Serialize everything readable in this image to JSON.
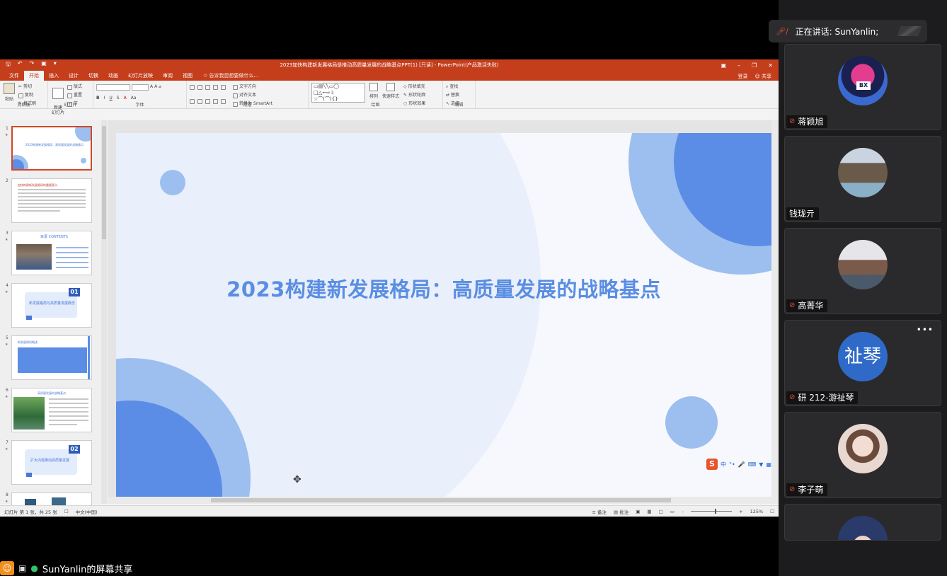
{
  "ppt": {
    "window_title": "2023加快构建新发展格局是推动高质量发展的战略基点PPT(1) [只读] - PowerPoint(产品激活失败)",
    "tabs": [
      "文件",
      "开始",
      "插入",
      "设计",
      "切换",
      "动画",
      "幻灯片放映",
      "审阅",
      "视图"
    ],
    "active_tab": "开始",
    "tell_me": "告诉我您想要做什么...",
    "login": "登录",
    "share": "共享",
    "ribbon": {
      "clipboard": {
        "paste": "粘贴",
        "cut": "剪切",
        "copy": "复制",
        "format_painter": "格式刷",
        "label": "剪贴板"
      },
      "slides": {
        "new_slide": "新建\n幻灯片",
        "layout": "版式",
        "reset": "重置",
        "section": "节",
        "label": "幻灯片"
      },
      "font": {
        "label": "字体",
        "bold": "B",
        "italic": "I",
        "underline": "U",
        "strike": "S",
        "aa": "Aa",
        "grow": "A",
        "shrink": "A"
      },
      "paragraph": {
        "label": "段落",
        "text_direction": "文字方向",
        "align_text": "对齐文本",
        "smartart": "转换为 SmartArt"
      },
      "drawing": {
        "label": "绘图",
        "arrange": "排列",
        "quick_styles": "快速样式",
        "fill": "形状填充",
        "outline": "形状轮廓",
        "effects": "形状效果"
      },
      "editing": {
        "label": "编辑",
        "find": "查找",
        "replace": "替换",
        "select": "选择"
      }
    },
    "thumbnails": [
      {
        "num": "1",
        "title": "2023构建新发展格局：高质量发展的战略基点"
      },
      {
        "num": "2",
        "title": "加快构建新发展格局的重要意义"
      },
      {
        "num": "3",
        "title": "目录 CONTENTS"
      },
      {
        "num": "4",
        "title": "新发展格局与高质量发展概念",
        "badge": "01"
      },
      {
        "num": "5",
        "title": "新发展格局概述"
      },
      {
        "num": "6",
        "title": "高质量发展的战略基点"
      },
      {
        "num": "7",
        "title": "扩大内需推动高质量发展",
        "badge": "02"
      },
      {
        "num": "8",
        "title": ""
      }
    ],
    "slide_title": "2023构建新发展格局：高质量发展的战略基点",
    "status": {
      "slide_info": "幻灯片 第 1 张，共 25 张",
      "language": "中文(中国)",
      "notes": "备注",
      "comments": "批注",
      "zoom": "125%"
    },
    "ime": {
      "logo": "S",
      "mode": "中"
    }
  },
  "meeting": {
    "speaking_label": "正在讲话: SunYanlin;",
    "participants": [
      {
        "name": "蒋颖旭",
        "muted": true
      },
      {
        "name": "钱珑亓",
        "muted": false
      },
      {
        "name": "高菁华",
        "muted": true
      },
      {
        "name": "研 212-游祉琴",
        "muted": true,
        "initials": "祉琴"
      },
      {
        "name": "李子萌",
        "muted": true
      },
      {
        "name": "",
        "muted": false
      }
    ],
    "share_label": "SunYanlin的屏幕共享"
  },
  "colors": {
    "ppt_accent": "#c43e1c",
    "slide_title": "#5a8ee2",
    "circle_dark": "#5b8de6",
    "circle_light": "#9dbfef",
    "muted_mic": "#e24c3c"
  }
}
